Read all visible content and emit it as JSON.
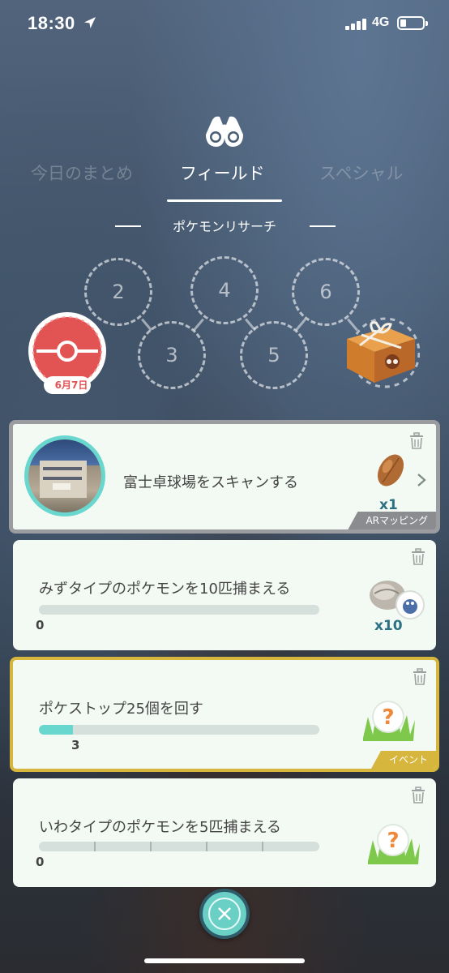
{
  "status_bar": {
    "time": "18:30",
    "network": "4G"
  },
  "tabs": [
    {
      "label": "今日のまとめ",
      "active": false
    },
    {
      "label": "フィールド",
      "active": true
    },
    {
      "label": "スペシャル",
      "active": false
    }
  ],
  "section_title": "ポケモンリサーチ",
  "stamps": {
    "slots": [
      "2",
      "3",
      "4",
      "5",
      "6"
    ],
    "first_stamp_date": "6月7日"
  },
  "tasks": [
    {
      "text": "富士卓球場をスキャンする",
      "reward_quantity": "x1",
      "tag": "ARマッピング",
      "reward_icon": "pinap-berry-icon"
    },
    {
      "text": "みずタイプのポケモンを10匹捕まえる",
      "progress_value": 0,
      "progress_max": 10,
      "progress_label": "0",
      "reward_quantity": "x10",
      "reward_icon": "stone-icon"
    },
    {
      "text": "ポケストップ25個を回す",
      "progress_value": 3,
      "progress_max": 25,
      "progress_label": "3",
      "tag": "イベント",
      "reward_icon": "mystery-encounter-icon"
    },
    {
      "text": "いわタイプのポケモンを5匹捕まえる",
      "progress_value": 0,
      "progress_max": 5,
      "progress_label": "0",
      "reward_icon": "mystery-encounter-icon"
    }
  ],
  "colors": {
    "accent_teal": "#6ad7cf",
    "event_gold": "#d7b63e",
    "stamp_red": "#e25353"
  }
}
